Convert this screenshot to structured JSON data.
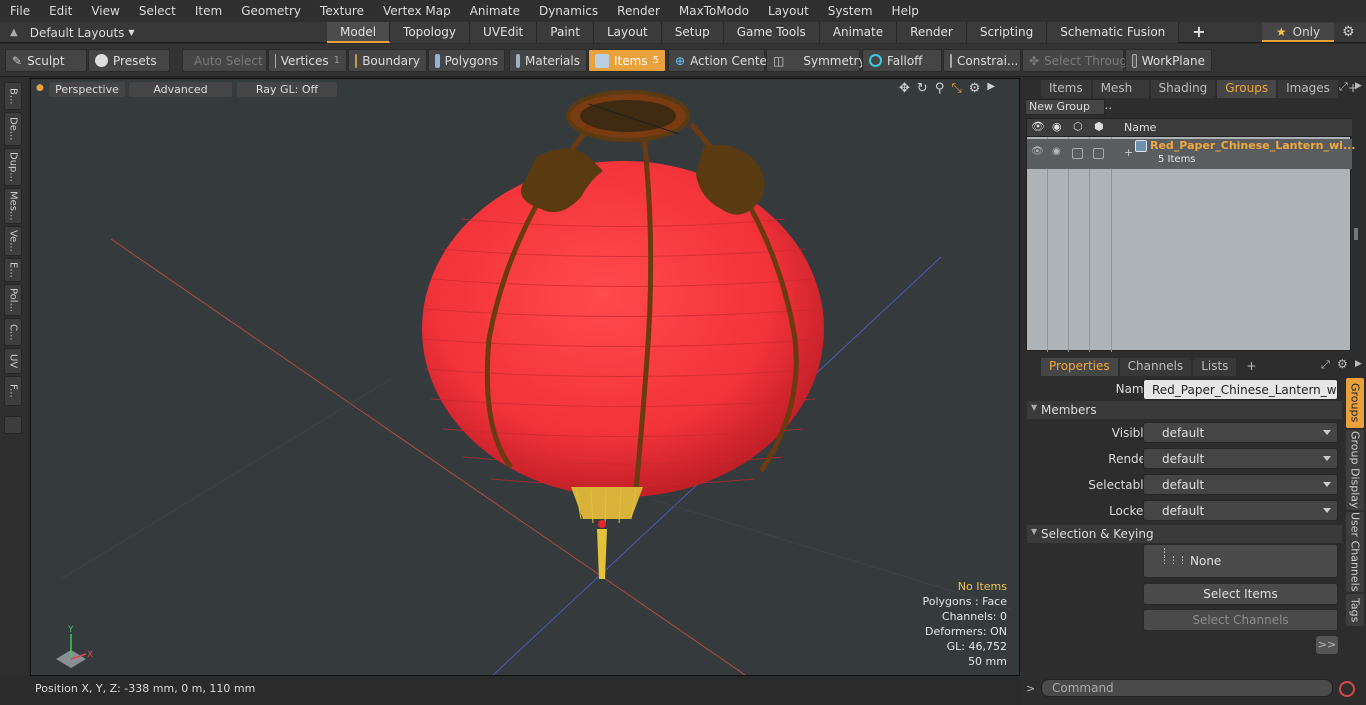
{
  "menubar": [
    "File",
    "Edit",
    "View",
    "Select",
    "Item",
    "Geometry",
    "Texture",
    "Vertex Map",
    "Animate",
    "Dynamics",
    "Render",
    "MaxToModo",
    "Layout",
    "System",
    "Help"
  ],
  "layouts": {
    "label": "Default Layouts"
  },
  "mode_tabs": [
    {
      "label": "Model",
      "active": true
    },
    {
      "label": "Topology"
    },
    {
      "label": "UVEdit"
    },
    {
      "label": "Paint"
    },
    {
      "label": "Layout"
    },
    {
      "label": "Setup"
    },
    {
      "label": "Game Tools"
    },
    {
      "label": "Animate"
    },
    {
      "label": "Render"
    },
    {
      "label": "Scripting"
    },
    {
      "label": "Schematic Fusion"
    }
  ],
  "only": {
    "label": "Only"
  },
  "toolbar": {
    "sculpt": "Sculpt",
    "presets": "Presets",
    "auto_select": "Auto Select",
    "vertices": "Vertices",
    "vertices_count": "1",
    "boundary": "Boundary",
    "polygons": "Polygons",
    "materials": "Materials",
    "items": "Items",
    "items_count": "5",
    "action_center": "Action Center",
    "symmetry": "Symmetry",
    "falloff": "Falloff",
    "constraints": "Constrai...",
    "select_through": "Select Through",
    "workplane": "WorkPlane"
  },
  "left_tabs": [
    "B...",
    "De...",
    "Dup...",
    "Mes...",
    "Ve...",
    "E...",
    "Pol...",
    "C...",
    "UV",
    "F..."
  ],
  "viewport": {
    "view": "Perspective",
    "shading": "Advanced",
    "raygl": "Ray GL: Off",
    "hud": {
      "selection": "No Items",
      "polygons": "Polygons : Face",
      "channels": "Channels: 0",
      "deformers": "Deformers: ON",
      "gl": "GL: 46,752",
      "scale": "50 mm"
    },
    "axis_x": "X",
    "axis_y": "Y"
  },
  "status": {
    "position": "Position X, Y, Z:  -338 mm, 0 m, 110 mm"
  },
  "right_tabs": [
    {
      "label": "Items"
    },
    {
      "label": "Mesh ..."
    },
    {
      "label": "Shading"
    },
    {
      "label": "Groups",
      "active": true
    },
    {
      "label": "Images"
    }
  ],
  "groups": {
    "new_group": "New Group",
    "col_name": "Name",
    "row_name": "Red_Paper_Chinese_Lantern_wi...",
    "row_count": "5 Items"
  },
  "prop_tabs": [
    {
      "label": "Properties",
      "active": true
    },
    {
      "label": "Channels"
    },
    {
      "label": "Lists"
    }
  ],
  "properties": {
    "name_label": "Name",
    "name_value": "Red_Paper_Chinese_Lantern_with_Ta",
    "members": "Members",
    "visible_label": "Visible",
    "visible_value": "default",
    "render_label": "Render",
    "render_value": "default",
    "selectable_label": "Selectable",
    "selectable_value": "default",
    "locked_label": "Locked",
    "locked_value": "default",
    "sel_keying": "Selection & Keying",
    "none": "None",
    "select_items": "Select Items",
    "select_channels": "Select Channels",
    "more": ">>"
  },
  "side_tabs": [
    {
      "label": "Groups",
      "active": true
    },
    {
      "label": "Group Display"
    },
    {
      "label": "User Channels"
    },
    {
      "label": "Tags"
    }
  ],
  "command": {
    "placeholder": "Command"
  },
  "colors": {
    "accent": "#e9a23b",
    "lantern": "#f2333a",
    "lantern_pattern": "#5a3a10",
    "tassel": "#e2c23a"
  }
}
